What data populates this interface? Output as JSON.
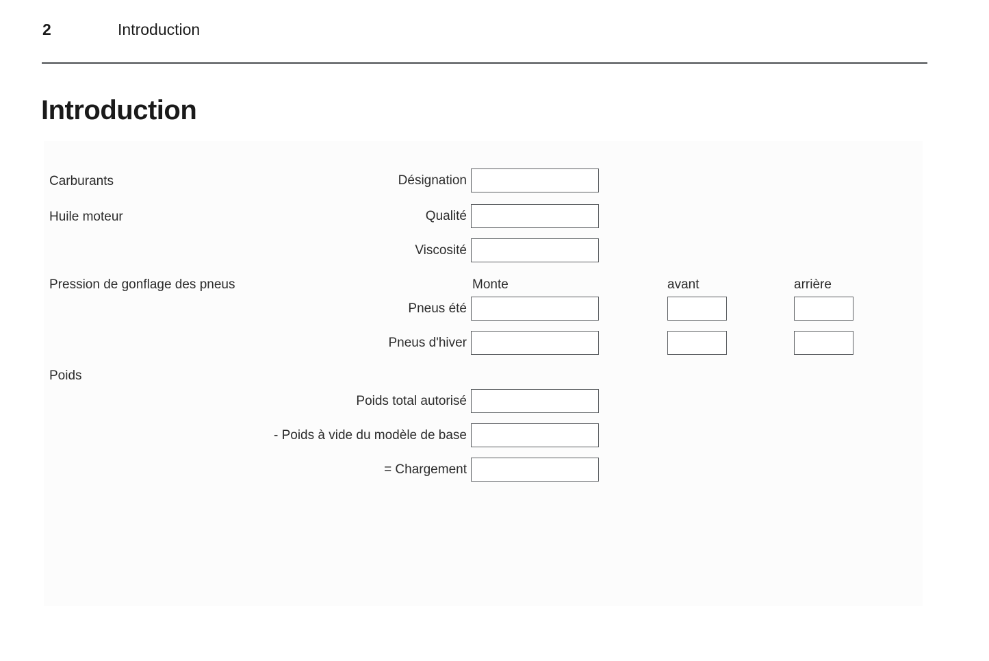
{
  "header": {
    "page_number": "2",
    "chapter_title": "Introduction"
  },
  "heading": "Introduction",
  "form": {
    "sections": {
      "fuels": "Carburants",
      "engine_oil": "Huile moteur",
      "tyre_pressure": "Pression de gonflage des pneus",
      "weights": "Poids"
    },
    "column_headers": {
      "mounting": "Monte",
      "front": "avant",
      "rear": "arrière"
    },
    "fields": {
      "designation": "Désignation",
      "quality": "Qualité",
      "viscosity": "Viscosité",
      "summer_tyres": "Pneus été",
      "winter_tyres": "Pneus d'hiver",
      "gross_weight": "Poids total autorisé",
      "kerb_weight": "- Poids à vide du modèle de base",
      "payload": "= Chargement"
    },
    "values": {
      "designation": "",
      "quality": "",
      "viscosity": "",
      "summer_mounting": "",
      "summer_front": "",
      "summer_rear": "",
      "winter_mounting": "",
      "winter_front": "",
      "winter_rear": "",
      "gross_weight": "",
      "kerb_weight": "",
      "payload": ""
    }
  },
  "colors": {
    "text": "#1a1a1a",
    "rule": "#4a4d50",
    "box_border": "#5a5d60",
    "panel_bg": "#fcfcfc"
  }
}
